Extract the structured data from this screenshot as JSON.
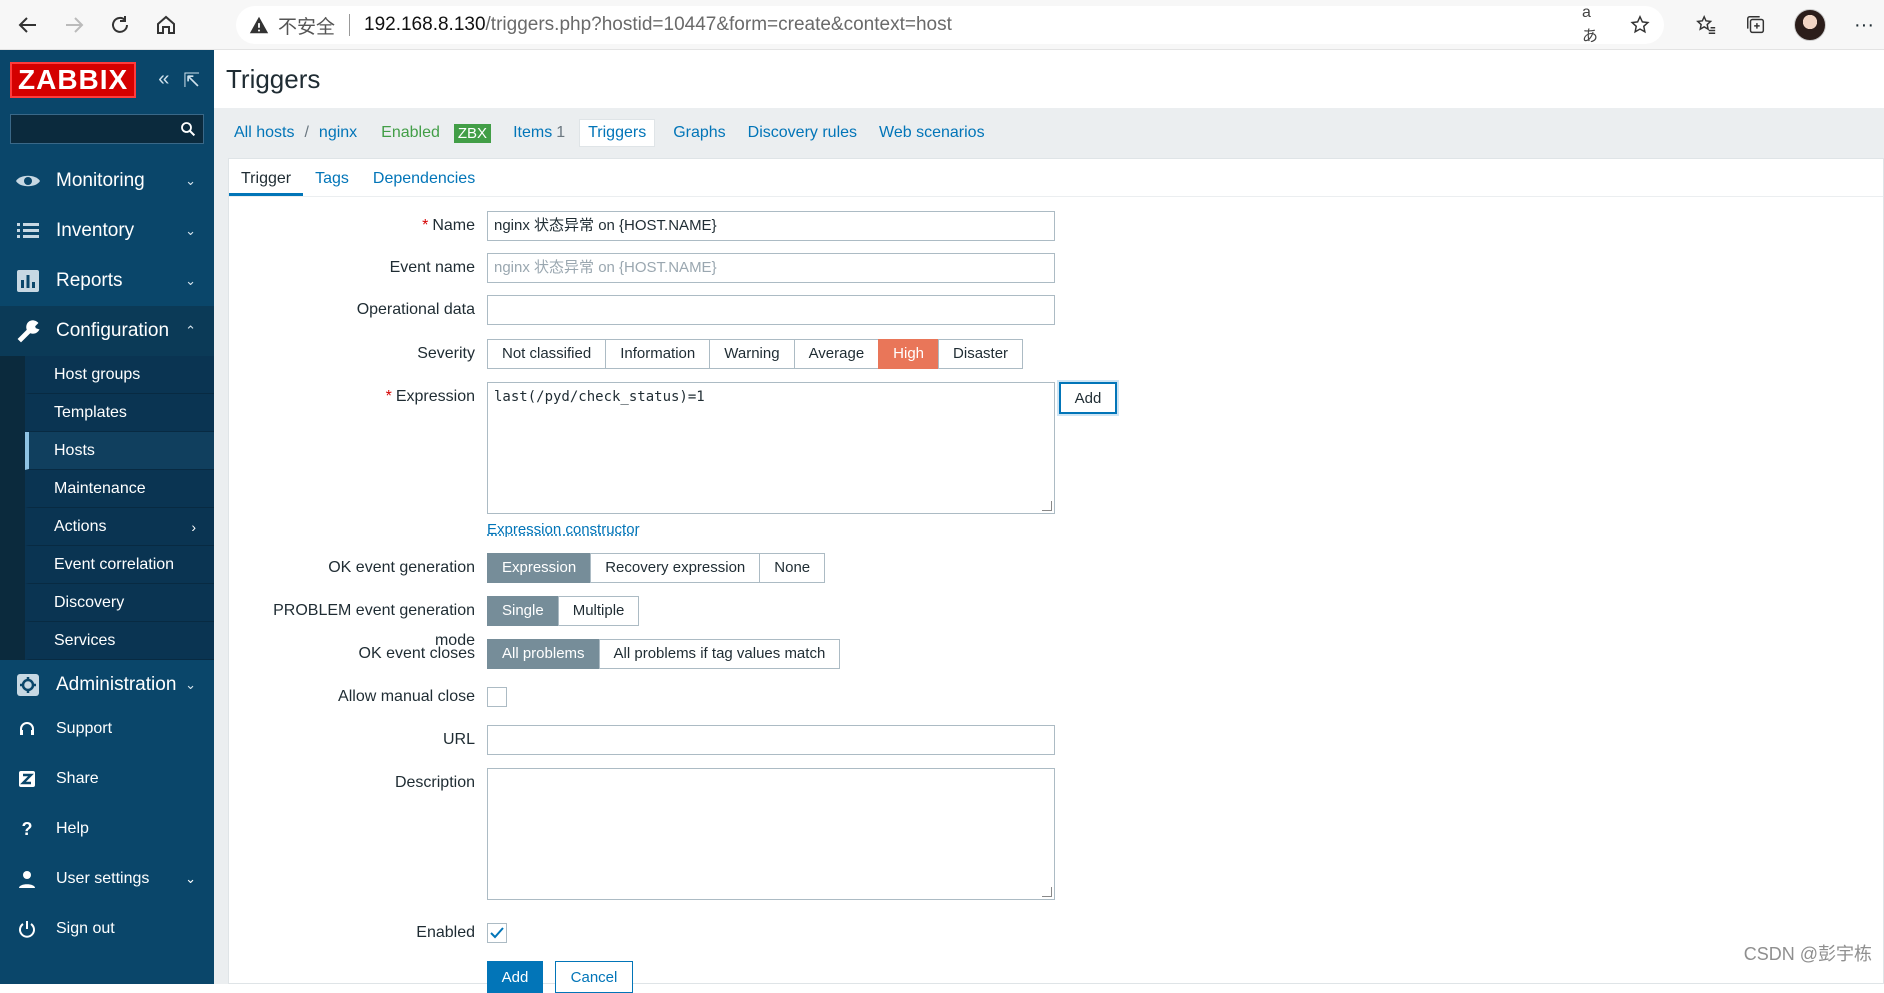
{
  "browser": {
    "insecure_label": "不安全",
    "url_host": "192.168.8.130",
    "url_rest": "/triggers.php?hostid=10447&form=create&context=host"
  },
  "sidebar": {
    "logo": "ZABBIX",
    "menu": [
      {
        "label": "Monitoring",
        "icon": "eye-icon"
      },
      {
        "label": "Inventory",
        "icon": "list-icon"
      },
      {
        "label": "Reports",
        "icon": "bar-chart-icon"
      },
      {
        "label": "Configuration",
        "icon": "wrench-icon"
      }
    ],
    "config_sub": [
      "Host groups",
      "Templates",
      "Hosts",
      "Maintenance",
      "Actions",
      "Event correlation",
      "Discovery",
      "Services"
    ],
    "administration": "Administration",
    "bottom": [
      {
        "label": "Support",
        "icon": "headset-icon"
      },
      {
        "label": "Share",
        "icon": "share-icon"
      },
      {
        "label": "Help",
        "icon": "help-icon"
      },
      {
        "label": "User settings",
        "icon": "user-icon"
      },
      {
        "label": "Sign out",
        "icon": "power-icon"
      }
    ]
  },
  "page": {
    "title": "Triggers"
  },
  "host_nav": {
    "all_hosts": "All hosts",
    "host": "nginx",
    "status": "Enabled",
    "zbx": "ZBX",
    "items": "Items",
    "items_count": "1",
    "triggers": "Triggers",
    "graphs": "Graphs",
    "discovery": "Discovery rules",
    "web": "Web scenarios"
  },
  "tabs": [
    "Trigger",
    "Tags",
    "Dependencies"
  ],
  "form": {
    "name_label": "Name",
    "name_value": "nginx 状态异常 on {HOST.NAME}",
    "event_name_label": "Event name",
    "event_name_placeholder": "nginx 状态异常 on {HOST.NAME}",
    "opdata_label": "Operational data",
    "severity_label": "Severity",
    "severities": [
      "Not classified",
      "Information",
      "Warning",
      "Average",
      "High",
      "Disaster"
    ],
    "severity_selected": "High",
    "expression_label": "Expression",
    "expression_value": "last(/pyd/check_status)=1",
    "add_button": "Add",
    "expression_constructor": "Expression constructor",
    "ok_event_label": "OK event generation",
    "ok_event_options": [
      "Expression",
      "Recovery expression",
      "None"
    ],
    "problem_mode_label": "PROBLEM event generation mode",
    "problem_mode_options": [
      "Single",
      "Multiple"
    ],
    "ok_closes_label": "OK event closes",
    "ok_closes_options": [
      "All problems",
      "All problems if tag values match"
    ],
    "manual_close_label": "Allow manual close",
    "url_label": "URL",
    "description_label": "Description",
    "enabled_label": "Enabled",
    "submit": "Add",
    "cancel": "Cancel"
  },
  "watermark": "CSDN @彭宇栋"
}
